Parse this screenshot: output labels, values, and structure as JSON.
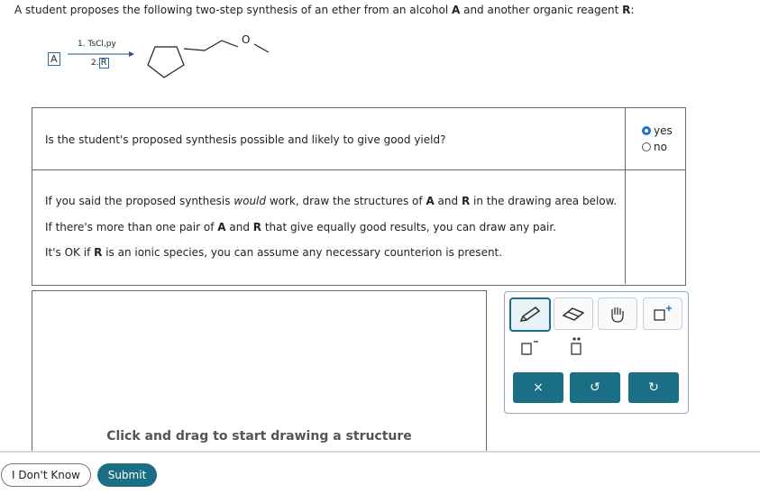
{
  "question": {
    "intro_pre": "A student proposes the following two-step synthesis of an ether from an alcohol ",
    "intro_a": "A",
    "intro_mid": " and another organic reagent ",
    "intro_r": "R",
    "intro_end": ":"
  },
  "scheme": {
    "reactant_label": "A",
    "step1": "1. TsCl,py",
    "step2_prefix": "2.",
    "step2_label": "R",
    "oxygen_label": "O"
  },
  "q1": {
    "text": "Is the student's proposed synthesis possible and likely to give good yield?",
    "options": [
      {
        "label": "yes",
        "selected": true
      },
      {
        "label": "no",
        "selected": false
      }
    ]
  },
  "q2": {
    "line1_pre": "If you said the proposed synthesis ",
    "line1_em": "would",
    "line1_mid": " work, draw the structures of ",
    "line1_a": "A",
    "line1_and": " and ",
    "line1_r": "R",
    "line1_end": " in the drawing area below.",
    "line2_pre": "If there's more than one pair of ",
    "line2_a": "A",
    "line2_and": " and ",
    "line2_r": "R",
    "line2_end": " that give equally good results, you can draw any pair.",
    "line3_pre": "It's OK if ",
    "line3_r": "R",
    "line3_end": " is an ionic species, you can assume any necessary counterion is present."
  },
  "drawing": {
    "hint": "Click and drag to start drawing a structure"
  },
  "palette": {
    "tools": [
      "pencil-icon",
      "eraser-icon",
      "hand-icon",
      "add-template-icon",
      "bracket-icon",
      "lone-pair-icon"
    ],
    "buttons": {
      "clear": "×",
      "undo": "↺",
      "redo": "↻"
    }
  },
  "footer": {
    "dont_know": "I Don't Know",
    "submit": "Submit"
  },
  "colors": {
    "accent": "#1a6f84",
    "radio_selected": "#1f6fd1",
    "label_box": "#2b6cb0"
  }
}
